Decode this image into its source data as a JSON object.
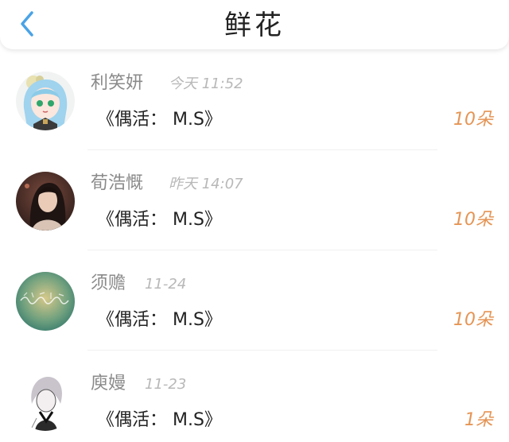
{
  "header": {
    "title": "鲜花",
    "back_icon": "chevron-left-icon",
    "accent_color": "#4aa3e6"
  },
  "records": [
    {
      "name": "利笑妍",
      "time": "今天 11:52",
      "work": "《偶活： M.S》",
      "count": "10朵",
      "avatar": "anime-girl-avatar"
    },
    {
      "name": "荀浩慨",
      "time": "昨天 14:07",
      "work": "《偶活： M.S》",
      "count": "10朵",
      "avatar": "portrait-photo-avatar"
    },
    {
      "name": "须赡",
      "time": "11-24",
      "work": "《偶活： M.S》",
      "count": "10朵",
      "avatar": "teal-handwriting-avatar"
    },
    {
      "name": "庾嫚",
      "time": "11-23",
      "work": "《偶活： M.S》",
      "count": "1朵",
      "avatar": "sketch-character-avatar"
    }
  ],
  "colors": {
    "count": "#e59555",
    "name": "#8a8a8a",
    "time": "#b8b8b8",
    "work": "#222222"
  }
}
